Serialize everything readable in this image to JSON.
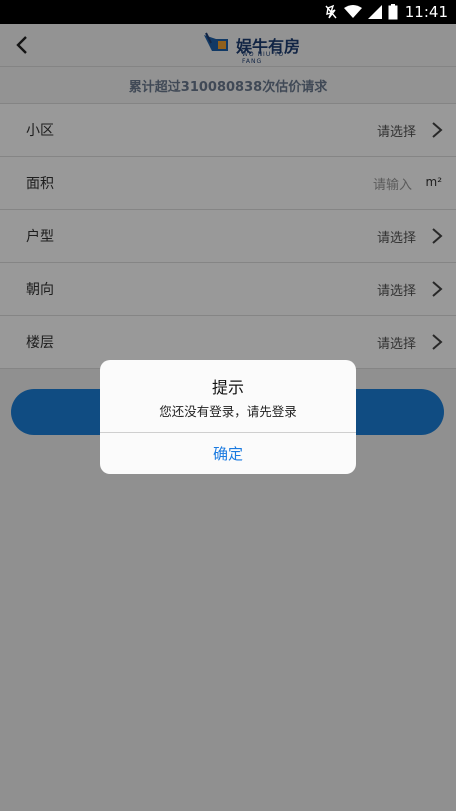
{
  "status_bar": {
    "time": "11:41"
  },
  "header": {
    "brand": "娱牛有房",
    "brand_sub": "WO NIU YO FANG"
  },
  "banner": {
    "text": "累计超过310080838次估价请求"
  },
  "form": {
    "rows": [
      {
        "label": "小区",
        "value": "请选择"
      },
      {
        "label": "面积",
        "placeholder": "请输入",
        "unit": "m²"
      },
      {
        "label": "户型",
        "value": "请选择"
      },
      {
        "label": "朝向",
        "value": "请选择"
      },
      {
        "label": "楼层",
        "value": "请选择"
      }
    ]
  },
  "dialog": {
    "title": "提示",
    "message": "您还没有登录，请先登录",
    "confirm": "确定"
  },
  "colors": {
    "accent": "#1b7fd9",
    "brand": "#1d3d72",
    "link": "#1a7ae0"
  }
}
